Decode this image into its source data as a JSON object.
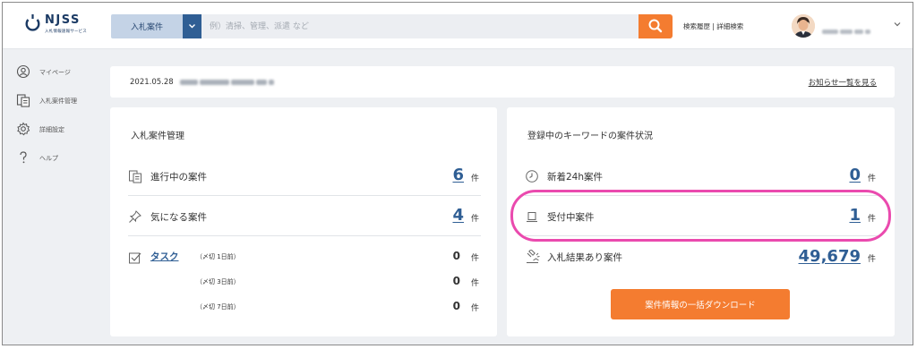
{
  "header": {
    "logo_text": "NJSS",
    "logo_sub": "入札情報速報サービス",
    "search_category": "入札案件",
    "search_placeholder": "例）清掃、管理、派遣 など",
    "search_history_link": "検索履歴",
    "search_separator": " | ",
    "advanced_search_link": "詳細検索"
  },
  "sidebar": {
    "items": [
      {
        "label": "マイページ",
        "icon": "user-circle-icon"
      },
      {
        "label": "入札案件管理",
        "icon": "documents-icon"
      },
      {
        "label": "詳細設定",
        "icon": "gear-icon"
      },
      {
        "label": "ヘルプ",
        "icon": "question-icon"
      }
    ]
  },
  "notice": {
    "date": "2021.05.28",
    "link": "お知らせ一覧を見る"
  },
  "management": {
    "title": "入札案件管理",
    "rows": [
      {
        "label": "進行中の案件",
        "count": "6",
        "unit": "件",
        "icon": "documents-icon"
      },
      {
        "label": "気になる案件",
        "count": "4",
        "unit": "件",
        "icon": "pin-icon"
      }
    ],
    "task": {
      "label": "タスク",
      "icon": "checkbox-icon",
      "items": [
        {
          "deadline": "（〆切 1日前）",
          "count": "0",
          "unit": "件"
        },
        {
          "deadline": "（〆切 3日前）",
          "count": "0",
          "unit": "件"
        },
        {
          "deadline": "（〆切 7日前）",
          "count": "0",
          "unit": "件"
        }
      ]
    }
  },
  "keyword_status": {
    "title": "登録中のキーワードの案件状況",
    "rows": [
      {
        "label": "新着24h案件",
        "count": "0",
        "unit": "件",
        "icon": "clock-icon"
      },
      {
        "label": "受付中案件",
        "count": "1",
        "unit": "件",
        "icon": "podium-icon"
      },
      {
        "label": "入札結果あり案件",
        "count": "49,679",
        "unit": "件",
        "icon": "gavel-icon"
      }
    ],
    "download_button": "案件情報の一括ダウンロード"
  },
  "colors": {
    "brand_navy": "#2f5e94",
    "accent_orange": "#f47c30",
    "highlight_pink": "#ea4aae"
  }
}
